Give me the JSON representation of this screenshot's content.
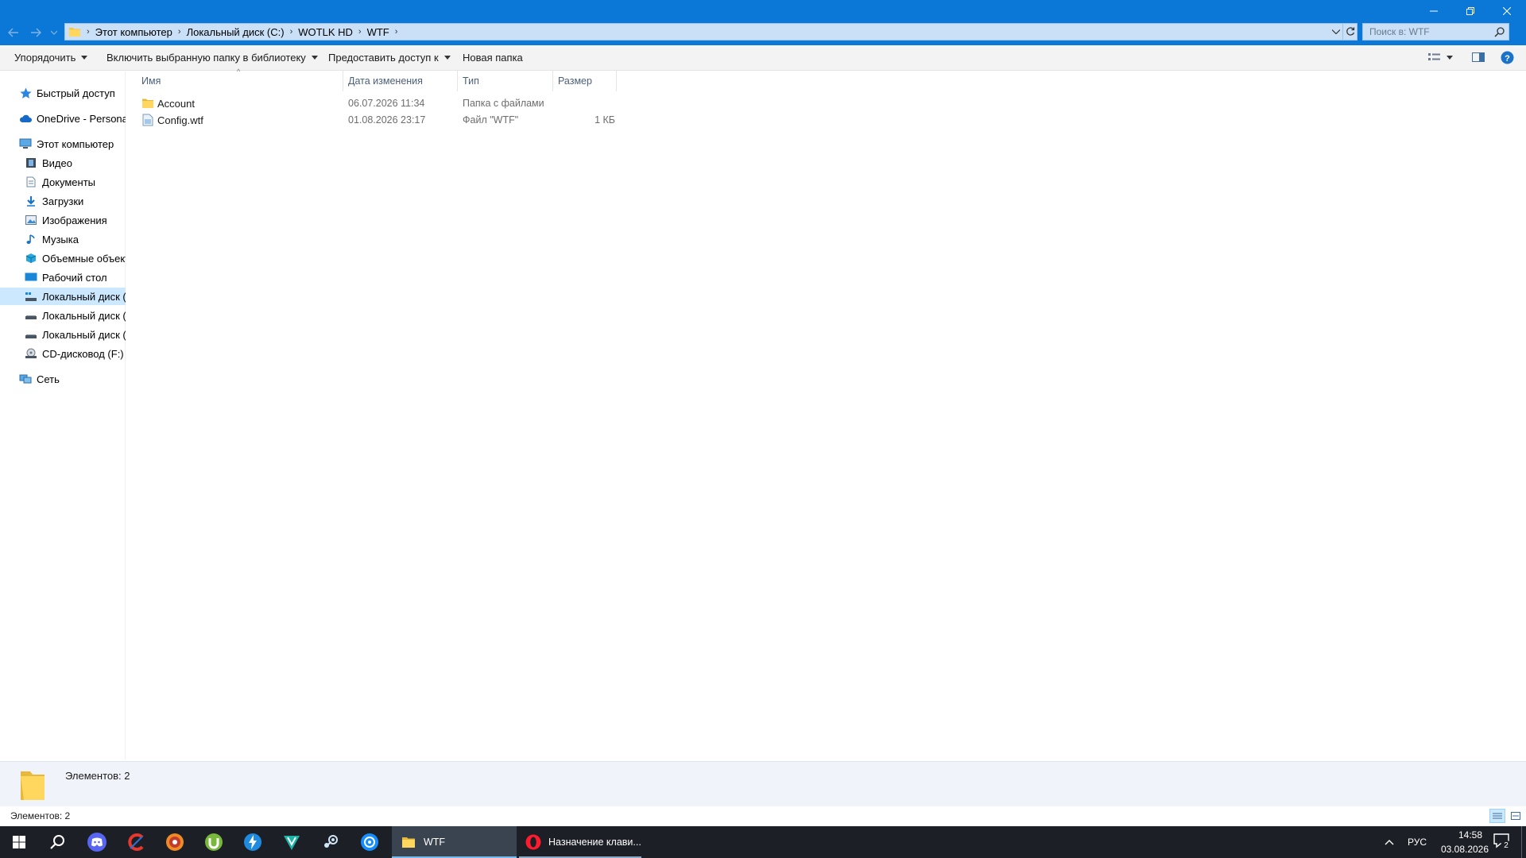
{
  "window": {
    "breadcrumb": [
      "Этот компьютер",
      "Локальный диск (C:)",
      "WOTLK HD",
      "WTF"
    ],
    "search_placeholder": "Поиск в: WTF",
    "accent_color": "#0b78d7"
  },
  "toolbar": {
    "organize": "Упорядочить",
    "include_library": "Включить выбранную папку в библиотеку",
    "share_with": "Предоставить доступ к",
    "new_folder": "Новая папка"
  },
  "nav": {
    "quick_access": "Быстрый доступ",
    "onedrive": "OneDrive - Personal",
    "this_pc": "Этот компьютер",
    "items": [
      {
        "label": "Видео",
        "icon": "video-icon"
      },
      {
        "label": "Документы",
        "icon": "documents-icon"
      },
      {
        "label": "Загрузки",
        "icon": "downloads-icon"
      },
      {
        "label": "Изображения",
        "icon": "pictures-icon"
      },
      {
        "label": "Музыка",
        "icon": "music-icon"
      },
      {
        "label": "Объемные объекты",
        "icon": "3d-objects-icon"
      },
      {
        "label": "Рабочий стол",
        "icon": "desktop-icon"
      },
      {
        "label": "Локальный диск (C:)",
        "icon": "drive-icon"
      },
      {
        "label": "Локальный диск (D:)",
        "icon": "drive-icon"
      },
      {
        "label": "Локальный диск (E:)",
        "icon": "drive-icon"
      },
      {
        "label": "CD-дисковод (F:)",
        "icon": "cd-drive-icon"
      }
    ],
    "network": "Сеть"
  },
  "columns": {
    "name": "Имя",
    "date": "Дата изменения",
    "type": "Тип",
    "size": "Размер"
  },
  "files": [
    {
      "name": "Account",
      "date": "06.07.2026 11:34",
      "type": "Папка с файлами",
      "size": "",
      "icon": "folder-icon"
    },
    {
      "name": "Config.wtf",
      "date": "01.08.2026 23:17",
      "type": "Файл \"WTF\"",
      "size": "1 КБ",
      "icon": "file-icon"
    }
  ],
  "details_pane": {
    "text": "Элементов: 2"
  },
  "status_bar": {
    "text": "Элементов: 2"
  },
  "taskbar": {
    "apps": [
      {
        "label": "WTF",
        "icon": "folder-icon",
        "active": true
      },
      {
        "label": "Назначение клави...",
        "icon": "opera-icon",
        "active": false
      }
    ],
    "language": "РУС",
    "time": "14:58",
    "date": "03.08.2026",
    "notifications_count": "2"
  }
}
